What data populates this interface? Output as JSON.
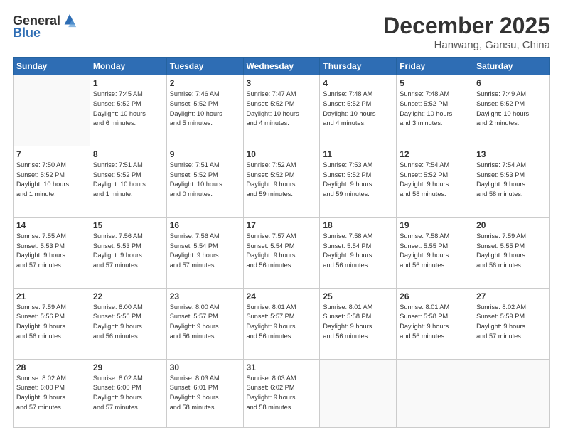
{
  "logo": {
    "general": "General",
    "blue": "Blue"
  },
  "title": "December 2025",
  "location": "Hanwang, Gansu, China",
  "days_header": [
    "Sunday",
    "Monday",
    "Tuesday",
    "Wednesday",
    "Thursday",
    "Friday",
    "Saturday"
  ],
  "weeks": [
    [
      {
        "day": "",
        "info": ""
      },
      {
        "day": "1",
        "info": "Sunrise: 7:45 AM\nSunset: 5:52 PM\nDaylight: 10 hours\nand 6 minutes."
      },
      {
        "day": "2",
        "info": "Sunrise: 7:46 AM\nSunset: 5:52 PM\nDaylight: 10 hours\nand 5 minutes."
      },
      {
        "day": "3",
        "info": "Sunrise: 7:47 AM\nSunset: 5:52 PM\nDaylight: 10 hours\nand 4 minutes."
      },
      {
        "day": "4",
        "info": "Sunrise: 7:48 AM\nSunset: 5:52 PM\nDaylight: 10 hours\nand 4 minutes."
      },
      {
        "day": "5",
        "info": "Sunrise: 7:48 AM\nSunset: 5:52 PM\nDaylight: 10 hours\nand 3 minutes."
      },
      {
        "day": "6",
        "info": "Sunrise: 7:49 AM\nSunset: 5:52 PM\nDaylight: 10 hours\nand 2 minutes."
      }
    ],
    [
      {
        "day": "7",
        "info": "Sunrise: 7:50 AM\nSunset: 5:52 PM\nDaylight: 10 hours\nand 1 minute."
      },
      {
        "day": "8",
        "info": "Sunrise: 7:51 AM\nSunset: 5:52 PM\nDaylight: 10 hours\nand 1 minute."
      },
      {
        "day": "9",
        "info": "Sunrise: 7:51 AM\nSunset: 5:52 PM\nDaylight: 10 hours\nand 0 minutes."
      },
      {
        "day": "10",
        "info": "Sunrise: 7:52 AM\nSunset: 5:52 PM\nDaylight: 9 hours\nand 59 minutes."
      },
      {
        "day": "11",
        "info": "Sunrise: 7:53 AM\nSunset: 5:52 PM\nDaylight: 9 hours\nand 59 minutes."
      },
      {
        "day": "12",
        "info": "Sunrise: 7:54 AM\nSunset: 5:52 PM\nDaylight: 9 hours\nand 58 minutes."
      },
      {
        "day": "13",
        "info": "Sunrise: 7:54 AM\nSunset: 5:53 PM\nDaylight: 9 hours\nand 58 minutes."
      }
    ],
    [
      {
        "day": "14",
        "info": "Sunrise: 7:55 AM\nSunset: 5:53 PM\nDaylight: 9 hours\nand 57 minutes."
      },
      {
        "day": "15",
        "info": "Sunrise: 7:56 AM\nSunset: 5:53 PM\nDaylight: 9 hours\nand 57 minutes."
      },
      {
        "day": "16",
        "info": "Sunrise: 7:56 AM\nSunset: 5:54 PM\nDaylight: 9 hours\nand 57 minutes."
      },
      {
        "day": "17",
        "info": "Sunrise: 7:57 AM\nSunset: 5:54 PM\nDaylight: 9 hours\nand 56 minutes."
      },
      {
        "day": "18",
        "info": "Sunrise: 7:58 AM\nSunset: 5:54 PM\nDaylight: 9 hours\nand 56 minutes."
      },
      {
        "day": "19",
        "info": "Sunrise: 7:58 AM\nSunset: 5:55 PM\nDaylight: 9 hours\nand 56 minutes."
      },
      {
        "day": "20",
        "info": "Sunrise: 7:59 AM\nSunset: 5:55 PM\nDaylight: 9 hours\nand 56 minutes."
      }
    ],
    [
      {
        "day": "21",
        "info": "Sunrise: 7:59 AM\nSunset: 5:56 PM\nDaylight: 9 hours\nand 56 minutes."
      },
      {
        "day": "22",
        "info": "Sunrise: 8:00 AM\nSunset: 5:56 PM\nDaylight: 9 hours\nand 56 minutes."
      },
      {
        "day": "23",
        "info": "Sunrise: 8:00 AM\nSunset: 5:57 PM\nDaylight: 9 hours\nand 56 minutes."
      },
      {
        "day": "24",
        "info": "Sunrise: 8:01 AM\nSunset: 5:57 PM\nDaylight: 9 hours\nand 56 minutes."
      },
      {
        "day": "25",
        "info": "Sunrise: 8:01 AM\nSunset: 5:58 PM\nDaylight: 9 hours\nand 56 minutes."
      },
      {
        "day": "26",
        "info": "Sunrise: 8:01 AM\nSunset: 5:58 PM\nDaylight: 9 hours\nand 56 minutes."
      },
      {
        "day": "27",
        "info": "Sunrise: 8:02 AM\nSunset: 5:59 PM\nDaylight: 9 hours\nand 57 minutes."
      }
    ],
    [
      {
        "day": "28",
        "info": "Sunrise: 8:02 AM\nSunset: 6:00 PM\nDaylight: 9 hours\nand 57 minutes."
      },
      {
        "day": "29",
        "info": "Sunrise: 8:02 AM\nSunset: 6:00 PM\nDaylight: 9 hours\nand 57 minutes."
      },
      {
        "day": "30",
        "info": "Sunrise: 8:03 AM\nSunset: 6:01 PM\nDaylight: 9 hours\nand 58 minutes."
      },
      {
        "day": "31",
        "info": "Sunrise: 8:03 AM\nSunset: 6:02 PM\nDaylight: 9 hours\nand 58 minutes."
      },
      {
        "day": "",
        "info": ""
      },
      {
        "day": "",
        "info": ""
      },
      {
        "day": "",
        "info": ""
      }
    ]
  ]
}
